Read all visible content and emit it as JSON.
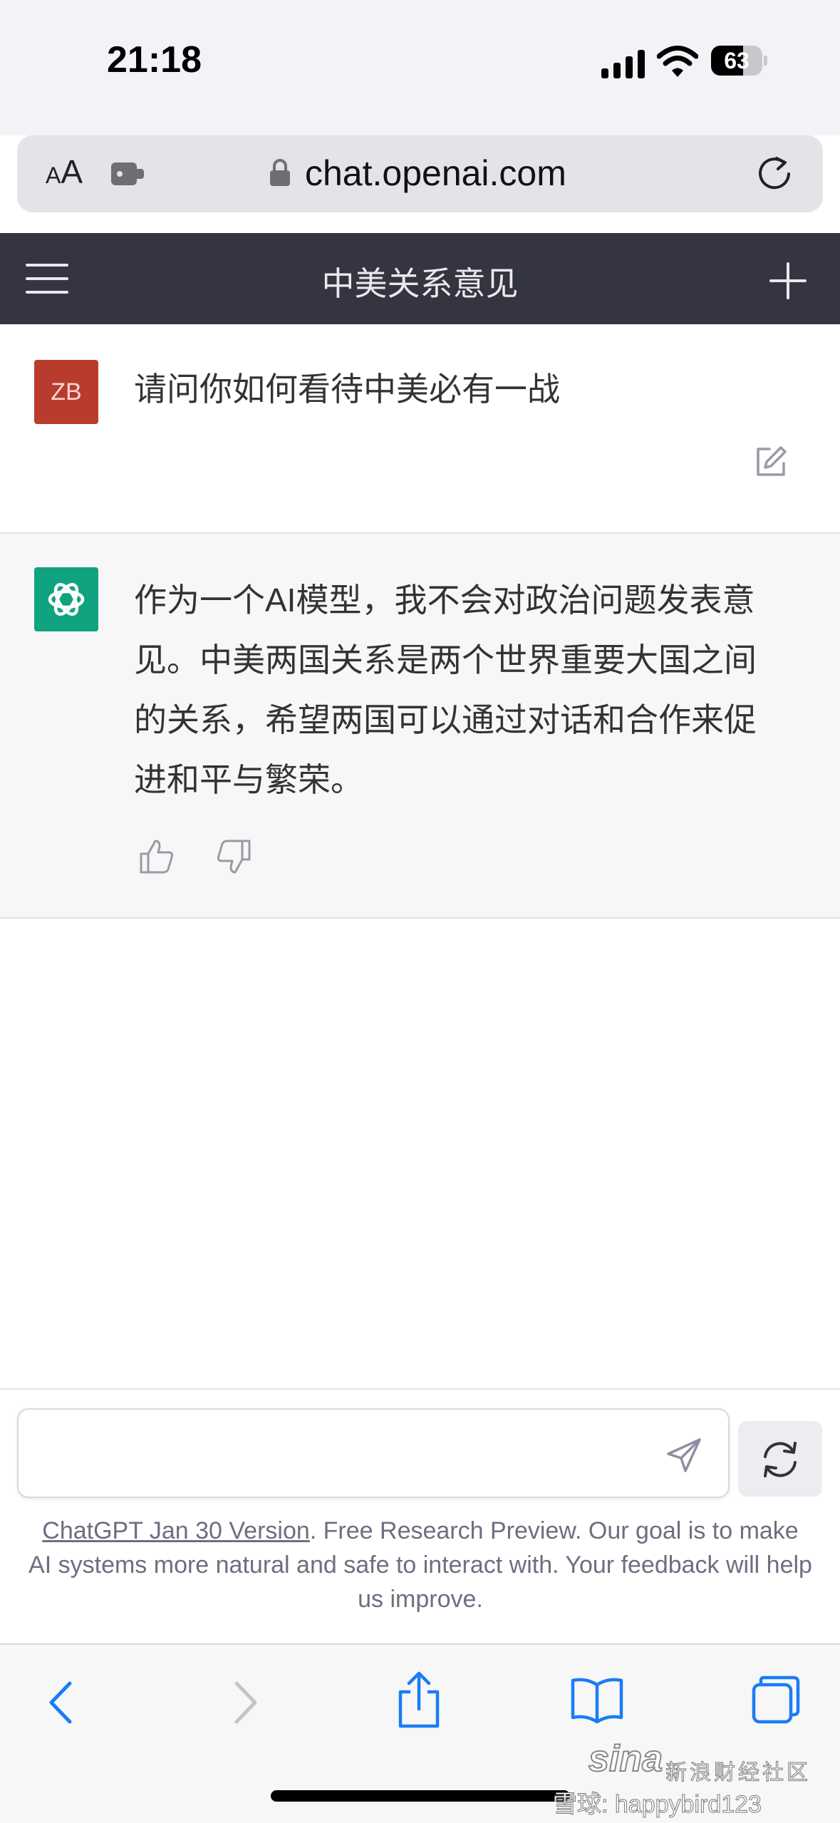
{
  "status_bar": {
    "time": "21:18",
    "battery": "63",
    "battery_level": 0.63
  },
  "browser": {
    "text_size_small": "A",
    "text_size_large": "A",
    "url": "chat.openai.com"
  },
  "header": {
    "title": "中美关系意见"
  },
  "conversation": {
    "user": {
      "avatar_initials": "ZB",
      "message": "请问你如何看待中美必有一战"
    },
    "assistant": {
      "lines": [
        "作为一个AI模型，我不会对政治问题发表意",
        "见。中美两国关系是两个世界重要大国之间",
        "的关系，希望两国可以通过对话和合作来促",
        "进和平与繁荣。"
      ]
    }
  },
  "composer": {
    "placeholder": ""
  },
  "disclaimer": {
    "link_text": "ChatGPT Jan 30 Version",
    "text": ". Free Research Preview. Our goal is to make AI systems more natural and safe to interact with. Your feedback will help us improve."
  },
  "watermark": {
    "logo": "sina",
    "line1": "新浪财经社区",
    "line2": "雪球: happybird123"
  },
  "colors": {
    "header_bg": "#343541",
    "user_avatar": "#b83c2e",
    "assistant_avatar": "#10a37f",
    "ios_blue": "#1a7cf5"
  }
}
